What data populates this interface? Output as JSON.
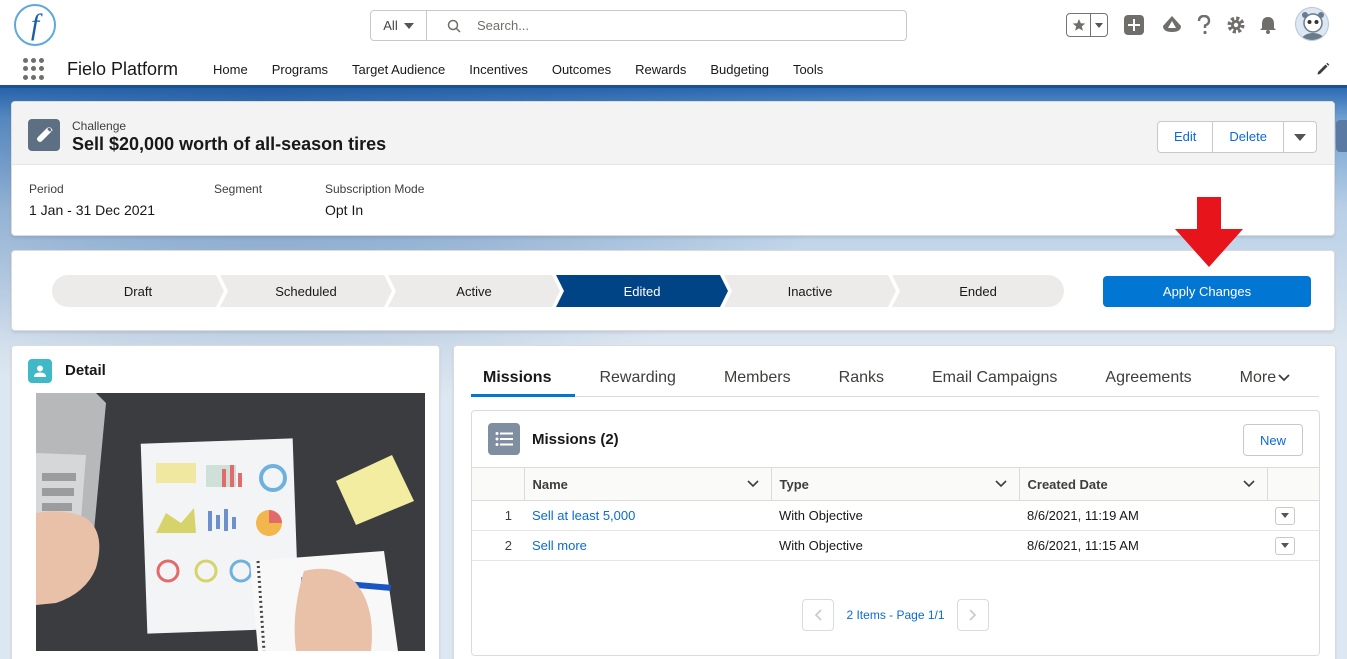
{
  "global": {
    "search_scope": "All",
    "search_placeholder": "Search..."
  },
  "app": {
    "name": "Fielo Platform",
    "nav": [
      "Home",
      "Programs",
      "Target Audience",
      "Incentives",
      "Outcomes",
      "Rewards",
      "Budgeting",
      "Tools"
    ]
  },
  "record": {
    "object_label": "Challenge",
    "title": "Sell $20,000 worth of all-season tires",
    "actions": {
      "edit": "Edit",
      "delete": "Delete"
    },
    "fields": [
      {
        "label": "Period",
        "value": "1 Jan - 31 Dec 2021"
      },
      {
        "label": "Segment",
        "value": ""
      },
      {
        "label": "Subscription Mode",
        "value": "Opt In"
      }
    ]
  },
  "path": {
    "stages": [
      "Draft",
      "Scheduled",
      "Active",
      "Edited",
      "Inactive",
      "Ended"
    ],
    "current": "Edited",
    "action_label": "Apply Changes"
  },
  "detail": {
    "title": "Detail"
  },
  "related": {
    "tabs": [
      "Missions",
      "Rewarding",
      "Members",
      "Ranks",
      "Email Campaigns",
      "Agreements"
    ],
    "more_label": "More",
    "active_tab": "Missions",
    "list_title": "Missions (2)",
    "new_label": "New",
    "columns": [
      "Name",
      "Type",
      "Created Date"
    ],
    "rows": [
      {
        "num": "1",
        "name": "Sell at least 5,000",
        "type": "With Objective",
        "created": "8/6/2021, 11:19 AM"
      },
      {
        "num": "2",
        "name": "Sell more",
        "type": "With Objective",
        "created": "8/6/2021, 11:15 AM"
      }
    ],
    "pager_text": "2 Items - Page 1/1"
  },
  "colors": {
    "brand_blue": "#0176d3",
    "path_current": "#014486",
    "nav_border": "#1b5297",
    "annotation_arrow": "#e8141b"
  }
}
